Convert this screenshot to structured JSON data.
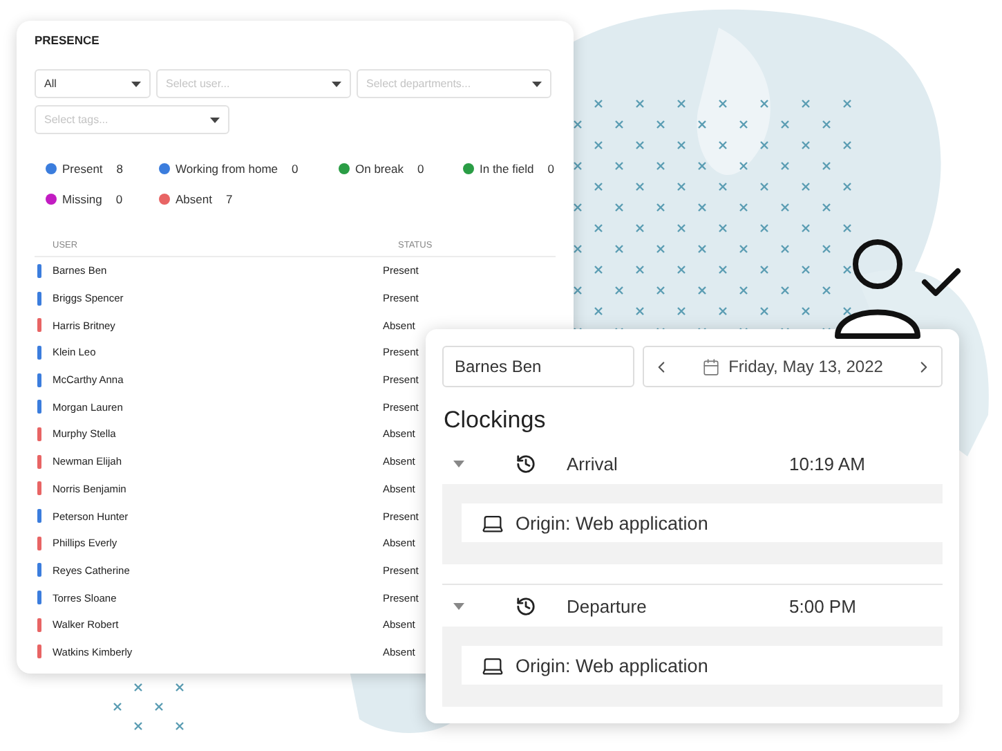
{
  "presence": {
    "title": "PRESENCE",
    "filters": [
      {
        "value": "All"
      },
      {
        "placeholder": "Select user..."
      },
      {
        "placeholder": "Select departments..."
      },
      {
        "placeholder": "Select tags..."
      }
    ],
    "legend": [
      {
        "label": "Present",
        "count": "8",
        "color": "#3b7ddd"
      },
      {
        "label": "Working from home",
        "count": "0",
        "color": "#3b7ddd"
      },
      {
        "label": "On break",
        "count": "0",
        "color": "#2a9d45"
      },
      {
        "label": "In the field",
        "count": "0",
        "color": "#2a9d45"
      },
      {
        "label": "Missing",
        "count": "0",
        "color": "#c21cc2"
      },
      {
        "label": "Absent",
        "count": "7",
        "color": "#e86464"
      }
    ],
    "table": {
      "columns": [
        "USER",
        "STATUS"
      ],
      "rows": [
        {
          "user": "Barnes Ben",
          "status": "Present",
          "color": "#3b7ddd"
        },
        {
          "user": "Briggs Spencer",
          "status": "Present",
          "color": "#3b7ddd"
        },
        {
          "user": "Harris Britney",
          "status": "Absent",
          "color": "#e86464"
        },
        {
          "user": "Klein Leo",
          "status": "Present",
          "color": "#3b7ddd"
        },
        {
          "user": "McCarthy Anna",
          "status": "Present",
          "color": "#3b7ddd"
        },
        {
          "user": "Morgan Lauren",
          "status": "Present",
          "color": "#3b7ddd"
        },
        {
          "user": "Murphy Stella",
          "status": "Absent",
          "color": "#e86464"
        },
        {
          "user": "Newman Elijah",
          "status": "Absent",
          "color": "#e86464"
        },
        {
          "user": "Norris Benjamin",
          "status": "Absent",
          "color": "#e86464"
        },
        {
          "user": "Peterson Hunter",
          "status": "Present",
          "color": "#3b7ddd"
        },
        {
          "user": "Phillips Everly",
          "status": "Absent",
          "color": "#e86464"
        },
        {
          "user": "Reyes Catherine",
          "status": "Present",
          "color": "#3b7ddd"
        },
        {
          "user": "Torres Sloane",
          "status": "Present",
          "color": "#3b7ddd"
        },
        {
          "user": "Walker Robert",
          "status": "Absent",
          "color": "#e86464"
        },
        {
          "user": "Watkins Kimberly",
          "status": "Absent",
          "color": "#e86464"
        }
      ]
    }
  },
  "clocking": {
    "user": "Barnes Ben",
    "date": "Friday, May 13, 2022",
    "title": "Clockings",
    "entries": [
      {
        "label": "Arrival",
        "time": "10:19 AM",
        "expanded": true,
        "origin": "Origin: Web application"
      },
      {
        "label": "Departure",
        "time": "5:00 PM",
        "expanded": true,
        "origin": "Origin: Web application"
      }
    ]
  }
}
